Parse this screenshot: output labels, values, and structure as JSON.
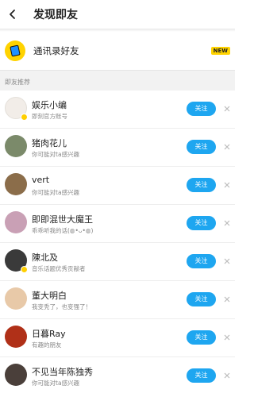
{
  "header": {
    "title": "发现即友"
  },
  "contacts": {
    "label": "通讯录好友",
    "badge": "NEW"
  },
  "section": {
    "title": "即友推荐"
  },
  "follow_label": "关注",
  "users": [
    {
      "name": "娱乐小编",
      "desc": "即刻官方账号",
      "avatar_color": "#f2ede8",
      "verified": true
    },
    {
      "name": "猪肉花儿",
      "desc": "你可能对ta感兴趣",
      "avatar_color": "#7b8a6a",
      "verified": false
    },
    {
      "name": "vert",
      "desc": "你可能对ta感兴趣",
      "avatar_color": "#8b6d4a",
      "verified": false
    },
    {
      "name": "即即混世大魔王",
      "desc": "乖乖听我的话(◍•ᴗ•◍)",
      "avatar_color": "#c9a0b5",
      "verified": false
    },
    {
      "name": "陳北及",
      "desc": "音乐话题优秀贡献者",
      "avatar_color": "#3a3a3a",
      "verified": true
    },
    {
      "name": "董大明白",
      "desc": "我变秃了，也变强了！",
      "avatar_color": "#e8c9a8",
      "verified": false
    },
    {
      "name": "日暮Ray",
      "desc": "有趣的朋友",
      "avatar_color": "#b03018",
      "verified": false
    },
    {
      "name": "不见当年陈独秀",
      "desc": "你可能对ta感兴趣",
      "avatar_color": "#4a3f3a",
      "verified": false
    }
  ]
}
